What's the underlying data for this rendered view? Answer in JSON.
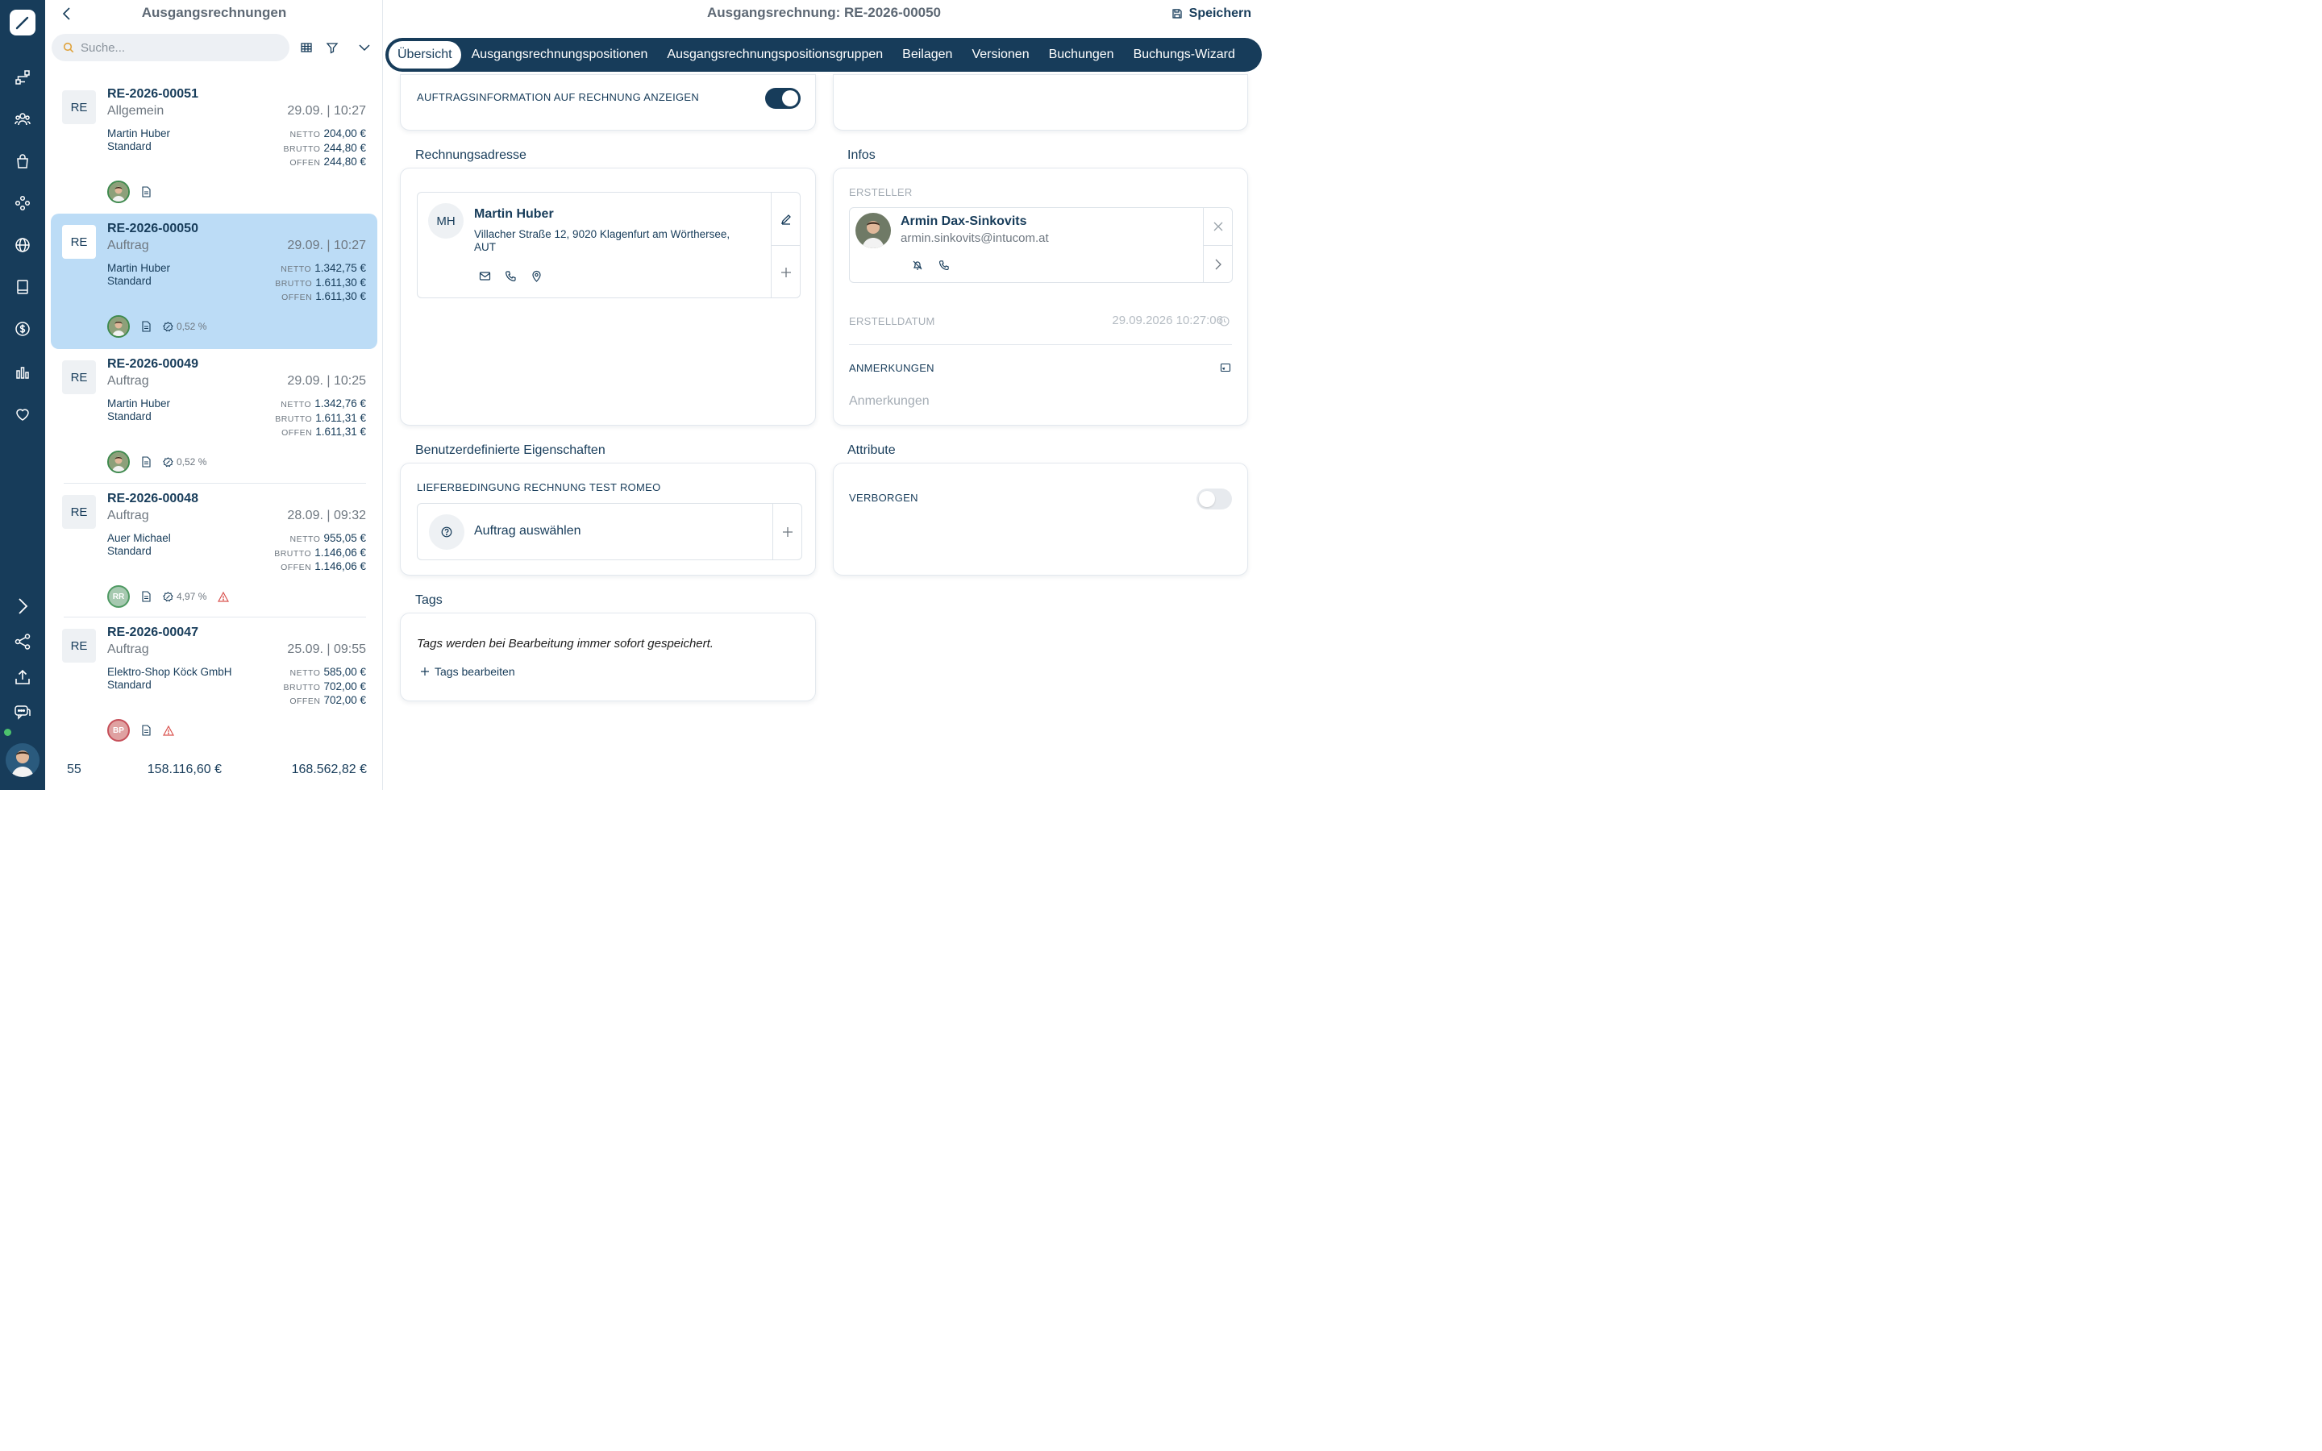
{
  "nav": {
    "items": [
      "pen-icon",
      "flow-icon",
      "users-icon",
      "bag-icon",
      "network-icon",
      "globe-icon",
      "book-icon",
      "dollar-icon",
      "chart-icon",
      "heart-icon"
    ],
    "bottom": [
      "chevron-right-icon",
      "share-icon",
      "upload-icon",
      "chat-icon"
    ]
  },
  "list": {
    "title": "Ausgangsrechnungen",
    "search_placeholder": "Suche...",
    "cards": [
      {
        "badge": "RE",
        "number": "RE-2026-00051",
        "kind": "Allgemein",
        "date": "29.09. | 10:27",
        "customer": "Martin Huber",
        "group": "Standard",
        "netto_label": "NETTO",
        "netto": "204,00 €",
        "brutto_label": "BRUTTO",
        "brutto": "244,80 €",
        "offen_label": "OFFEN",
        "offen": "244,80 €",
        "pct": ""
      },
      {
        "badge": "RE",
        "number": "RE-2026-00050",
        "kind": "Auftrag",
        "date": "29.09. | 10:27",
        "customer": "Martin Huber",
        "group": "Standard",
        "netto_label": "NETTO",
        "netto": "1.342,75 €",
        "brutto_label": "BRUTTO",
        "brutto": "1.611,30 €",
        "offen_label": "OFFEN",
        "offen": "1.611,30 €",
        "pct": "0,52 %"
      },
      {
        "badge": "RE",
        "number": "RE-2026-00049",
        "kind": "Auftrag",
        "date": "29.09. | 10:25",
        "customer": "Martin Huber",
        "group": "Standard",
        "netto_label": "NETTO",
        "netto": "1.342,76 €",
        "brutto_label": "BRUTTO",
        "brutto": "1.611,31 €",
        "offen_label": "OFFEN",
        "offen": "1.611,31 €",
        "pct": "0,52 %"
      },
      {
        "badge": "RE",
        "number": "RE-2026-00048",
        "kind": "Auftrag",
        "date": "28.09. | 09:32",
        "customer": "Auer Michael",
        "group": "Standard",
        "netto_label": "NETTO",
        "netto": "955,05 €",
        "brutto_label": "BRUTTO",
        "brutto": "1.146,06 €",
        "offen_label": "OFFEN",
        "offen": "1.146,06 €",
        "pct": "4,97 %",
        "avatar_initials": "RR"
      },
      {
        "badge": "RE",
        "number": "RE-2026-00047",
        "kind": "Auftrag",
        "date": "25.09. | 09:55",
        "customer": "Elektro-Shop Köck GmbH",
        "group": "Standard",
        "netto_label": "NETTO",
        "netto": "585,00 €",
        "brutto_label": "BRUTTO",
        "brutto": "702,00 €",
        "offen_label": "OFFEN",
        "offen": "702,00 €",
        "pct": "",
        "avatar_initials": "BP"
      }
    ],
    "footer": {
      "count": "55",
      "netto_total": "158.116,60 €",
      "brutto_total": "168.562,82 €"
    }
  },
  "header": {
    "title": "Ausgangsrechnung: RE-2026-00050",
    "save_label": "Speichern"
  },
  "tabs": [
    "Übersicht",
    "Ausgangsrechnungspositionen",
    "Ausgangsrechnungspositionsgruppen",
    "Beilagen",
    "Versionen",
    "Buchungen",
    "Buchungs-Wizard"
  ],
  "order_info": {
    "label": "AUFTRAGSINFORMATION AUF RECHNUNG ANZEIGEN",
    "enabled": true
  },
  "billing": {
    "section": "Rechnungsadresse",
    "initials": "MH",
    "name": "Martin Huber",
    "address": "Villacher Straße 12, 9020 Klagenfurt am Wörthersee, AUT"
  },
  "infos": {
    "section": "Infos",
    "creator_label": "ERSTELLER",
    "creator_name": "Armin Dax-Sinkovits",
    "creator_email": "armin.sinkovits@intucom.at",
    "created_label": "ERSTELLDATUM",
    "created_value": "29.09.2026 10:27:06",
    "notes_label": "ANMERKUNGEN",
    "notes_placeholder": "Anmerkungen"
  },
  "custom": {
    "section": "Benutzerdefinierte Eigenschaften",
    "field_label": "LIEFERBEDINGUNG RECHNUNG TEST ROMEO",
    "select_label": "Auftrag auswählen"
  },
  "attributes": {
    "section": "Attribute",
    "hidden_label": "VERBORGEN",
    "hidden": false
  },
  "tags": {
    "section": "Tags",
    "info": "Tags werden bei Bearbeitung immer sofort gespeichert.",
    "edit_label": "Tags bearbeiten"
  },
  "colors": {
    "primary": "#173c5a",
    "selected": "#bcdcf6",
    "warning": "#d9534f",
    "online": "#4cc36d"
  }
}
